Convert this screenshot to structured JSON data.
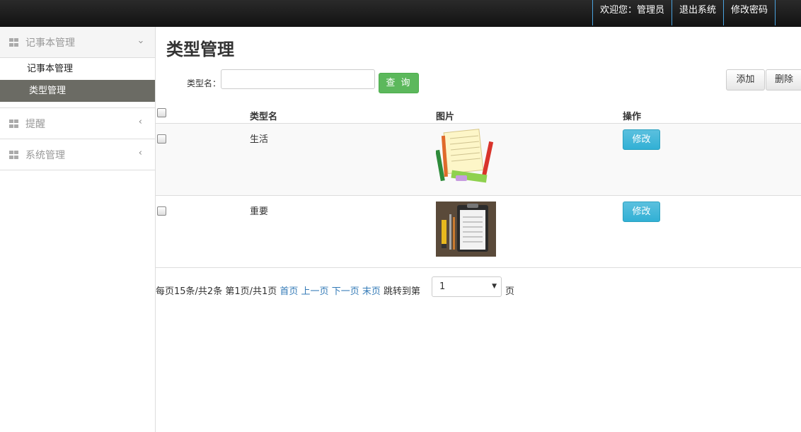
{
  "topnav": {
    "welcome": "欢迎您：管理员",
    "logout": "退出系统",
    "change_password": "修改密码"
  },
  "sidebar": {
    "groups": [
      {
        "label": "记事本管理",
        "expanded": true,
        "items": [
          "记事本管理",
          "类型管理"
        ],
        "active": "类型管理"
      },
      {
        "label": "提醒",
        "expanded": false
      },
      {
        "label": "系统管理",
        "expanded": false
      }
    ]
  },
  "main": {
    "title": "类型管理",
    "search": {
      "label": "类型名：",
      "value": "",
      "query_button": "查 询"
    },
    "actions": {
      "add": "添加",
      "delete": "删除"
    },
    "table": {
      "headers": [
        "类型名",
        "图片",
        "操作"
      ],
      "rows": [
        {
          "name": "生活",
          "image": "stationery-icon",
          "action": "修改"
        },
        {
          "name": "重要",
          "image": "clipboard-icon",
          "action": "修改"
        }
      ]
    },
    "pager": {
      "summary": "每页15条/共2条 第1页/共1页",
      "first": "首页",
      "prev": "上一页",
      "next": "下一页",
      "last": "末页",
      "jump_label": "跳转到第",
      "current": "1",
      "unit": "页"
    }
  },
  "colors": {
    "primary_green": "#5cb85c",
    "info_blue": "#5bc0de",
    "sidebar_active": "#6b6b64",
    "topbar": "#1a1a1a"
  }
}
